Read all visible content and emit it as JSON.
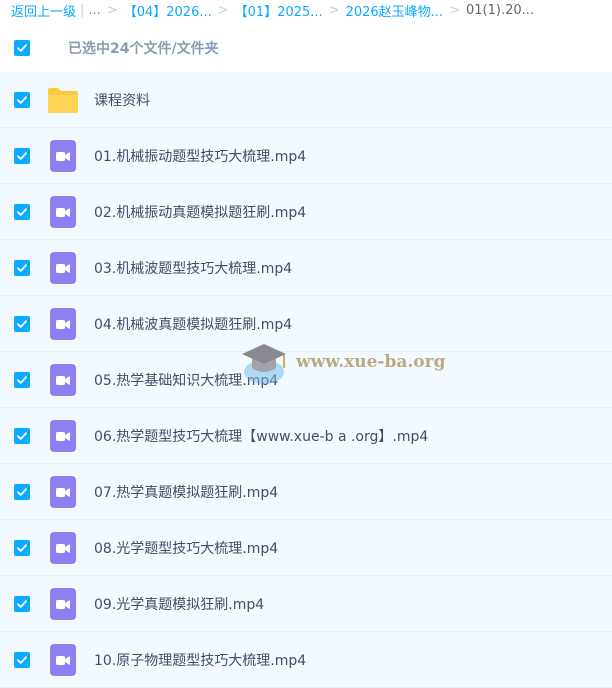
{
  "breadcrumb": {
    "back": "返回上一级",
    "pipe": "|",
    "ellipsis": "...",
    "sep": ">",
    "items": [
      "【04】2026...",
      "【01】2025...",
      "2026赵玉峰物..."
    ],
    "current": "01(1).20..."
  },
  "selection": {
    "text": "已选中24个文件/文件夹"
  },
  "files": [
    {
      "name": "课程资料",
      "type": "folder"
    },
    {
      "name": "01.机械振动题型技巧大梳理.mp4",
      "type": "video"
    },
    {
      "name": "02.机械振动真题模拟题狂刷.mp4",
      "type": "video"
    },
    {
      "name": "03.机械波题型技巧大梳理.mp4",
      "type": "video"
    },
    {
      "name": "04.机械波真题模拟题狂刷.mp4",
      "type": "video"
    },
    {
      "name": "05.热学基础知识大梳理.mp4",
      "type": "video"
    },
    {
      "name": "06.热学题型技巧大梳理【www.xue-b a .org】.mp4",
      "type": "video"
    },
    {
      "name": "07.热学真题模拟题狂刷.mp4",
      "type": "video"
    },
    {
      "name": "08.光学题型技巧大梳理.mp4",
      "type": "video"
    },
    {
      "name": "09.光学真题模拟狂刷.mp4",
      "type": "video"
    },
    {
      "name": "10.原子物理题型技巧大梳理.mp4",
      "type": "video"
    }
  ],
  "watermark": {
    "text": "www.xue-ba.org"
  },
  "colors": {
    "accent": "#09aaff",
    "row_bg": "#f2f9ff",
    "folder": "#ffc93d",
    "video": "#8e7ff0"
  }
}
